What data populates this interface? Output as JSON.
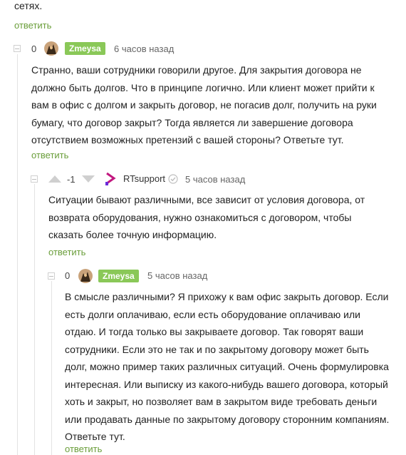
{
  "top": {
    "text": "сетях.",
    "reply": "ответить"
  },
  "comments": [
    {
      "rating": "0",
      "author": "Zmeysa",
      "time": "6 часов назад",
      "text": "Странно, ваши сотрудники говорили другое. Для закрытия договора не должно быть долгов. Что в принципе логично. Или клиент может прийти к вам в офис с долгом и закрыть договор, не погасив долг, получить на руки бумагу, что договор закрыт? Тогда является ли завершение договора отсутствием возможных претензий с вашей стороны? Ответьте тут.",
      "reply": "ответить"
    },
    {
      "rating": "-1",
      "author": "RTsupport",
      "time": "5 часов назад",
      "text": "Ситуации бывают различными, все зависит от условия договора, от возврата оборудования, нужно ознакомиться с договором, чтобы сказать более точную информацию.",
      "reply": "ответить"
    },
    {
      "rating": "0",
      "author": "Zmeysa",
      "time": "5 часов назад",
      "text": "В смысле различными? Я прихожу к вам офис закрыть договор. Если есть долги оплачиваю, если есть оборудование оплачиваю или отдаю. И тогда только вы закрываете договор. Так говорят ваши сотрудники. Если это не так и по закрытому договору может быть долг, можно пример таких различных ситуаций. Очень формулировка интересная. Или выписку из какого-нибудь вашего договора, который хоть и закрыт, но позволяет вам в закрытом виде требовать деньги или продавать данные по закрытому договору сторонним компаниям. Ответьте тут.",
      "reply": "ответить"
    }
  ],
  "colors": {
    "accent_green": "#8ac858",
    "reply_green": "#6a9e3a",
    "brand_magenta": "#c2187f"
  }
}
